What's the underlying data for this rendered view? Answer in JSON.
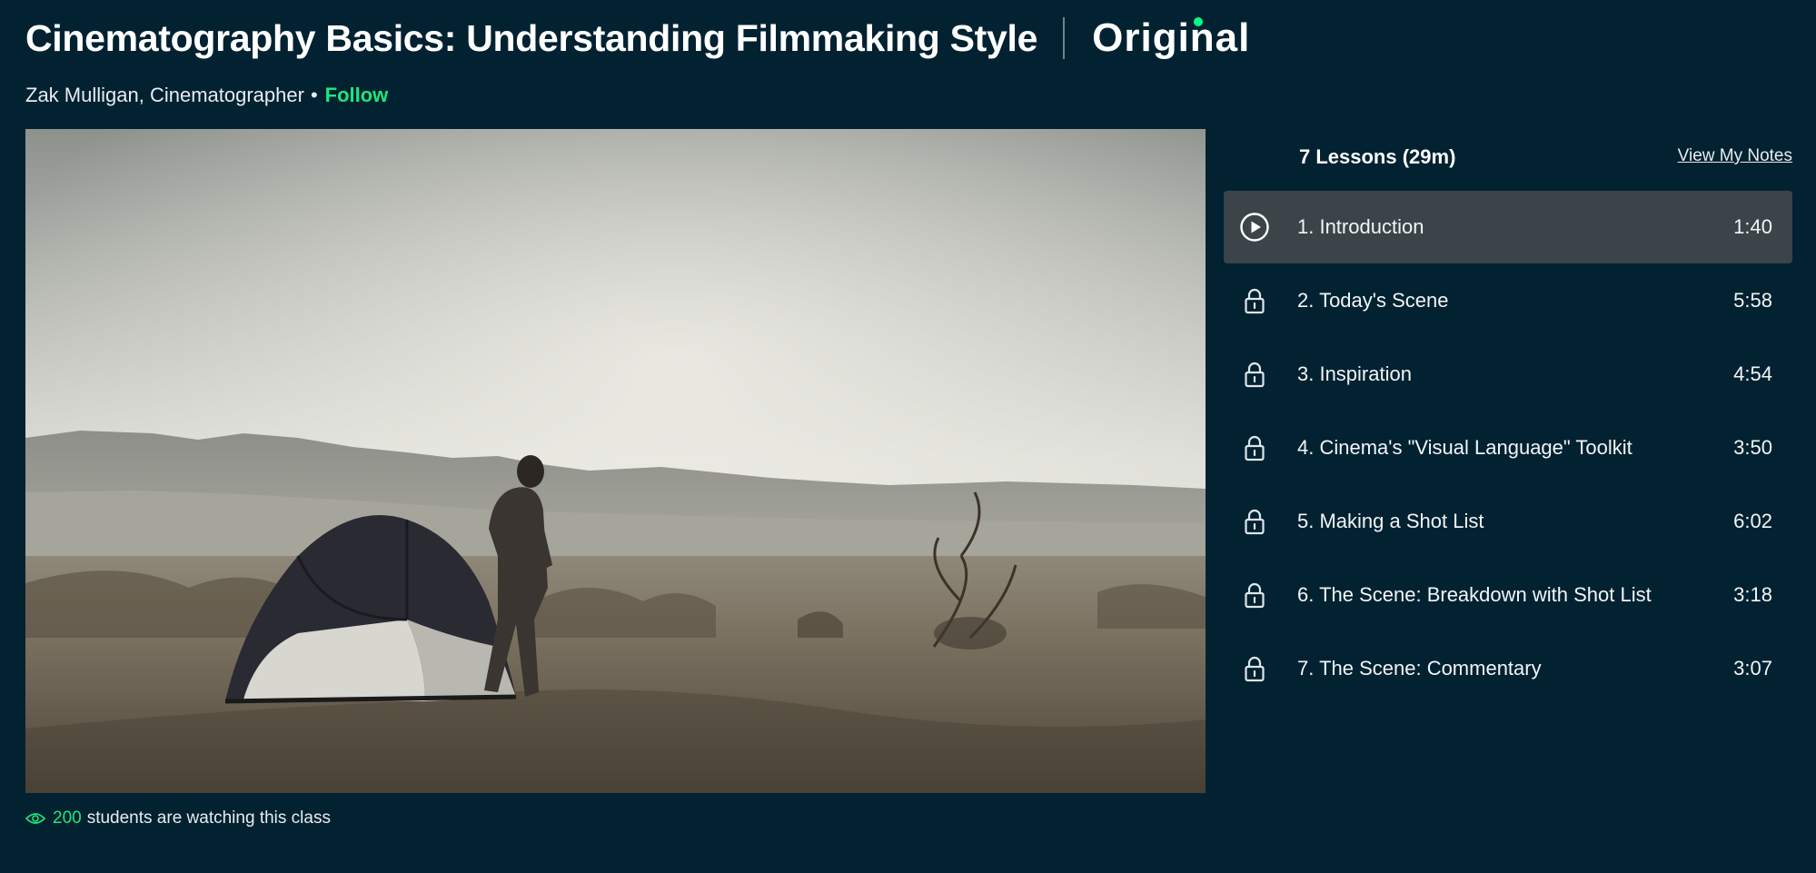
{
  "course": {
    "title": "Cinematography Basics: Understanding Filmmaking Style",
    "badge": "Original",
    "instructor": "Zak Mulligan, Cinematographer",
    "bullet": "•",
    "follow_label": "Follow"
  },
  "video": {
    "watching_count": "200",
    "watching_text": "students are watching this class"
  },
  "lessons_panel": {
    "summary": "7 Lessons (29m)",
    "notes_link": "View My Notes",
    "items": [
      {
        "title": "1. Introduction",
        "duration": "1:40",
        "icon": "play-icon",
        "active": true
      },
      {
        "title": "2. Today's Scene",
        "duration": "5:58",
        "icon": "lock-icon",
        "active": false
      },
      {
        "title": "3. Inspiration",
        "duration": "4:54",
        "icon": "lock-icon",
        "active": false
      },
      {
        "title": "4. Cinema's \"Visual Language\" Toolkit",
        "duration": "3:50",
        "icon": "lock-icon",
        "active": false
      },
      {
        "title": "5. Making a Shot List",
        "duration": "6:02",
        "icon": "lock-icon",
        "active": false
      },
      {
        "title": "6. The Scene: Breakdown with Shot List",
        "duration": "3:18",
        "icon": "lock-icon",
        "active": false
      },
      {
        "title": "7. The Scene: Commentary",
        "duration": "3:07",
        "icon": "lock-icon",
        "active": false
      }
    ]
  },
  "colors": {
    "background": "#022231",
    "accent": "#1ee67a",
    "active_row": "#3b4449"
  }
}
